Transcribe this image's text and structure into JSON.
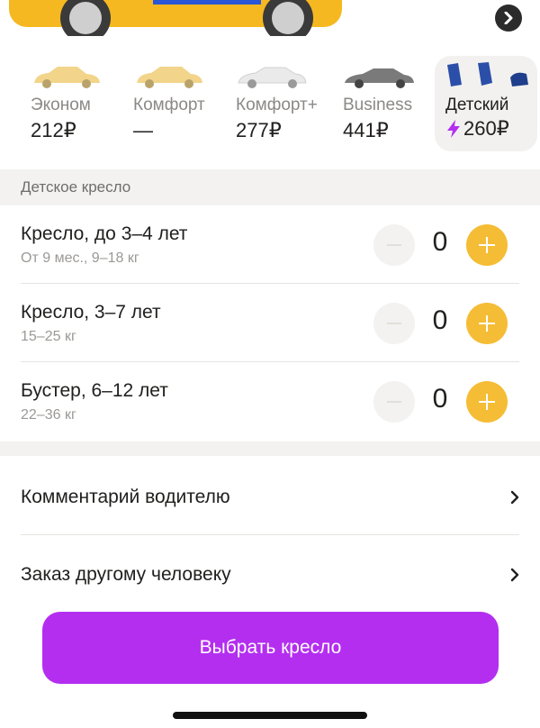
{
  "hero": {
    "expand_icon": "chevron-right-icon"
  },
  "tariffs": [
    {
      "name": "Эконом",
      "price": "212₽",
      "car_color": "#f2d48a"
    },
    {
      "name": "Комфорт",
      "price": "—",
      "car_color": "#f2d48a"
    },
    {
      "name": "Комфорт+",
      "price": "277₽",
      "car_color": "#e8e8e8"
    },
    {
      "name": "Business",
      "price": "441₽",
      "car_color": "#6a6a6a"
    },
    {
      "name": "Детский",
      "price": "260₽",
      "selected": true,
      "icon": "bolt-icon",
      "icon_color": "#b42ef0"
    }
  ],
  "seats_section": {
    "header": "Детское кресло",
    "items": [
      {
        "title": "Кресло, до 3–4 лет",
        "subtitle": "От 9 мес., 9–18 кг",
        "count": "0"
      },
      {
        "title": "Кресло, 3–7 лет",
        "subtitle": "15–25 кг",
        "count": "0"
      },
      {
        "title": "Бустер, 6–12 лет",
        "subtitle": "22–36 кг",
        "count": "0"
      }
    ]
  },
  "options": [
    {
      "label": "Комментарий водителю"
    },
    {
      "label": "Заказ другому человеку"
    }
  ],
  "cta": {
    "label": "Выбрать кресло"
  },
  "colors": {
    "accent": "#f5bd35",
    "cta": "#b42ef0",
    "muted": "#8b8986"
  }
}
